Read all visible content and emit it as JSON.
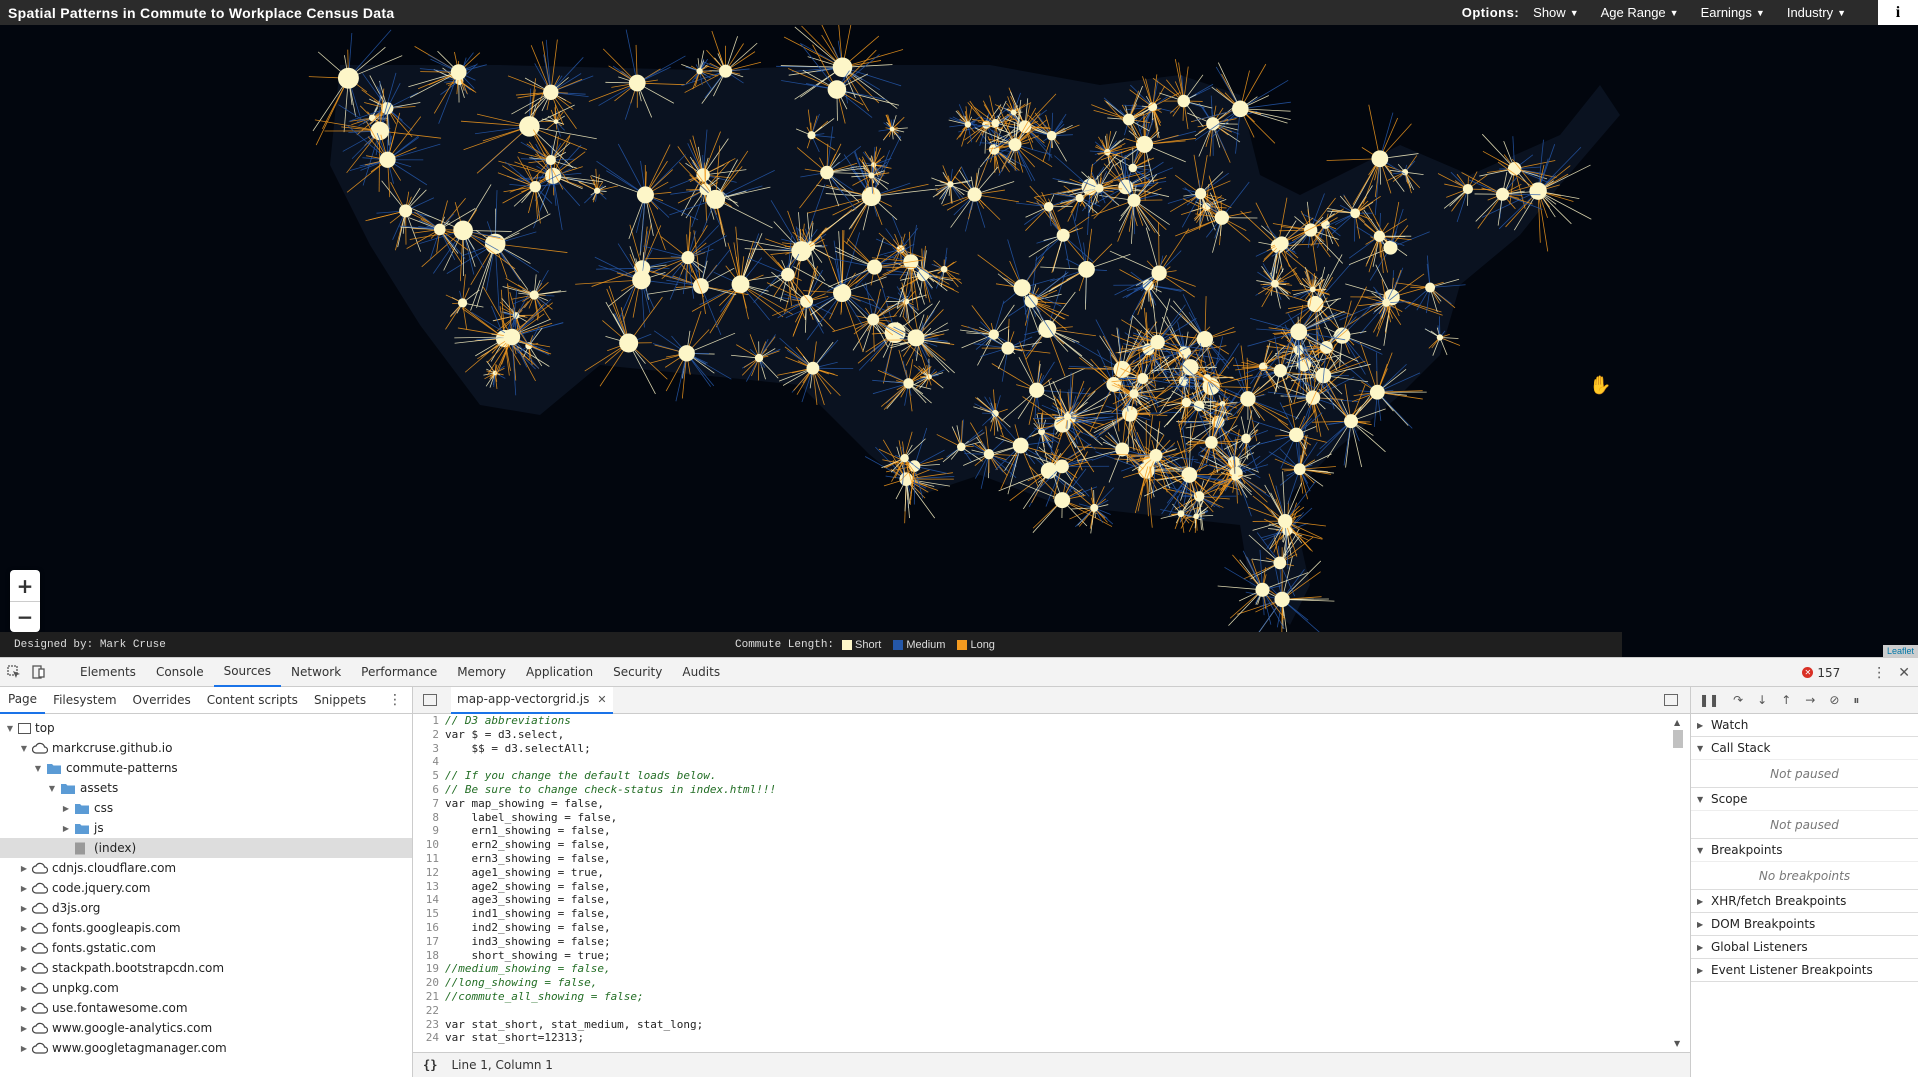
{
  "app": {
    "title": "Spatial Patterns in Commute to Workplace Census Data",
    "options_label": "Options:",
    "menus": [
      "Show",
      "Age Range",
      "Earnings",
      "Industry"
    ],
    "info_icon": "i"
  },
  "map": {
    "zoom_in": "+",
    "zoom_out": "−",
    "designed_by": "Designed by: Mark Cruse",
    "legend_title": "Commute Length:",
    "legend": [
      {
        "label": "Short",
        "color": "#fdf6c8"
      },
      {
        "label": "Medium",
        "color": "#2457a8"
      },
      {
        "label": "Long",
        "color": "#f39a1f"
      }
    ],
    "attribution": "Leaflet"
  },
  "devtools": {
    "tabs": [
      "Elements",
      "Console",
      "Sources",
      "Network",
      "Performance",
      "Memory",
      "Application",
      "Security",
      "Audits"
    ],
    "active_tab": "Sources",
    "error_count": "157",
    "navigator_tabs": [
      "Page",
      "Filesystem",
      "Overrides",
      "Content scripts",
      "Snippets"
    ],
    "tree": [
      {
        "label": "top",
        "depth": 0,
        "icon": "frame",
        "arrow": "▼"
      },
      {
        "label": "markcruse.github.io",
        "depth": 1,
        "icon": "cloud",
        "arrow": "▼"
      },
      {
        "label": "commute-patterns",
        "depth": 2,
        "icon": "folder",
        "arrow": "▼"
      },
      {
        "label": "assets",
        "depth": 3,
        "icon": "folder",
        "arrow": "▼"
      },
      {
        "label": "css",
        "depth": 4,
        "icon": "folder",
        "arrow": "▶"
      },
      {
        "label": "js",
        "depth": 4,
        "icon": "folder",
        "arrow": "▶"
      },
      {
        "label": "(index)",
        "depth": 4,
        "icon": "file",
        "arrow": "",
        "selected": true
      },
      {
        "label": "cdnjs.cloudflare.com",
        "depth": 1,
        "icon": "cloud",
        "arrow": "▶"
      },
      {
        "label": "code.jquery.com",
        "depth": 1,
        "icon": "cloud",
        "arrow": "▶"
      },
      {
        "label": "d3js.org",
        "depth": 1,
        "icon": "cloud",
        "arrow": "▶"
      },
      {
        "label": "fonts.googleapis.com",
        "depth": 1,
        "icon": "cloud",
        "arrow": "▶"
      },
      {
        "label": "fonts.gstatic.com",
        "depth": 1,
        "icon": "cloud",
        "arrow": "▶"
      },
      {
        "label": "stackpath.bootstrapcdn.com",
        "depth": 1,
        "icon": "cloud",
        "arrow": "▶"
      },
      {
        "label": "unpkg.com",
        "depth": 1,
        "icon": "cloud",
        "arrow": "▶"
      },
      {
        "label": "use.fontawesome.com",
        "depth": 1,
        "icon": "cloud",
        "arrow": "▶"
      },
      {
        "label": "www.google-analytics.com",
        "depth": 1,
        "icon": "cloud",
        "arrow": "▶"
      },
      {
        "label": "www.googletagmanager.com",
        "depth": 1,
        "icon": "cloud",
        "arrow": "▶"
      }
    ],
    "editor_file": "map-app-vectorgrid.js",
    "code": [
      {
        "n": "1",
        "t": "// D3 abbreviations",
        "c": true
      },
      {
        "n": "2",
        "t": "var $ = d3.select,",
        "c": false
      },
      {
        "n": "3",
        "t": "    $$ = d3.selectAll;",
        "c": false
      },
      {
        "n": "4",
        "t": "",
        "c": false
      },
      {
        "n": "5",
        "t": "// If you change the default loads below.",
        "c": true
      },
      {
        "n": "6",
        "t": "// Be sure to change check-status in index.html!!!",
        "c": true
      },
      {
        "n": "7",
        "t": "var map_showing = false,",
        "c": false
      },
      {
        "n": "8",
        "t": "    label_showing = false,",
        "c": false
      },
      {
        "n": "9",
        "t": "    ern1_showing = false,",
        "c": false
      },
      {
        "n": "10",
        "t": "    ern2_showing = false,",
        "c": false
      },
      {
        "n": "11",
        "t": "    ern3_showing = false,",
        "c": false
      },
      {
        "n": "12",
        "t": "    age1_showing = true,",
        "c": false
      },
      {
        "n": "13",
        "t": "    age2_showing = false,",
        "c": false
      },
      {
        "n": "14",
        "t": "    age3_showing = false,",
        "c": false
      },
      {
        "n": "15",
        "t": "    ind1_showing = false,",
        "c": false
      },
      {
        "n": "16",
        "t": "    ind2_showing = false,",
        "c": false
      },
      {
        "n": "17",
        "t": "    ind3_showing = false;",
        "c": false
      },
      {
        "n": "18",
        "t": "    short_showing = true;",
        "c": false
      },
      {
        "n": "19",
        "t": "//medium_showing = false,",
        "c": true
      },
      {
        "n": "20",
        "t": "//long_showing = false,",
        "c": true
      },
      {
        "n": "21",
        "t": "//commute_all_showing = false;",
        "c": true
      },
      {
        "n": "22",
        "t": "",
        "c": false
      },
      {
        "n": "23",
        "t": "var stat_short, stat_medium, stat_long;",
        "c": false
      },
      {
        "n": "24",
        "t": "var stat_short=12313;",
        "c": false
      }
    ],
    "status": {
      "braces": "{}",
      "position": "Line 1, Column 1"
    },
    "debugger": [
      {
        "label": "Watch",
        "arrow": "▶",
        "body": ""
      },
      {
        "label": "Call Stack",
        "arrow": "▼",
        "body": "Not paused"
      },
      {
        "label": "Scope",
        "arrow": "▼",
        "body": "Not paused"
      },
      {
        "label": "Breakpoints",
        "arrow": "▼",
        "body": "No breakpoints"
      },
      {
        "label": "XHR/fetch Breakpoints",
        "arrow": "▶",
        "body": ""
      },
      {
        "label": "DOM Breakpoints",
        "arrow": "▶",
        "body": ""
      },
      {
        "label": "Global Listeners",
        "arrow": "▶",
        "body": ""
      },
      {
        "label": "Event Listener Breakpoints",
        "arrow": "▶",
        "body": ""
      }
    ]
  }
}
